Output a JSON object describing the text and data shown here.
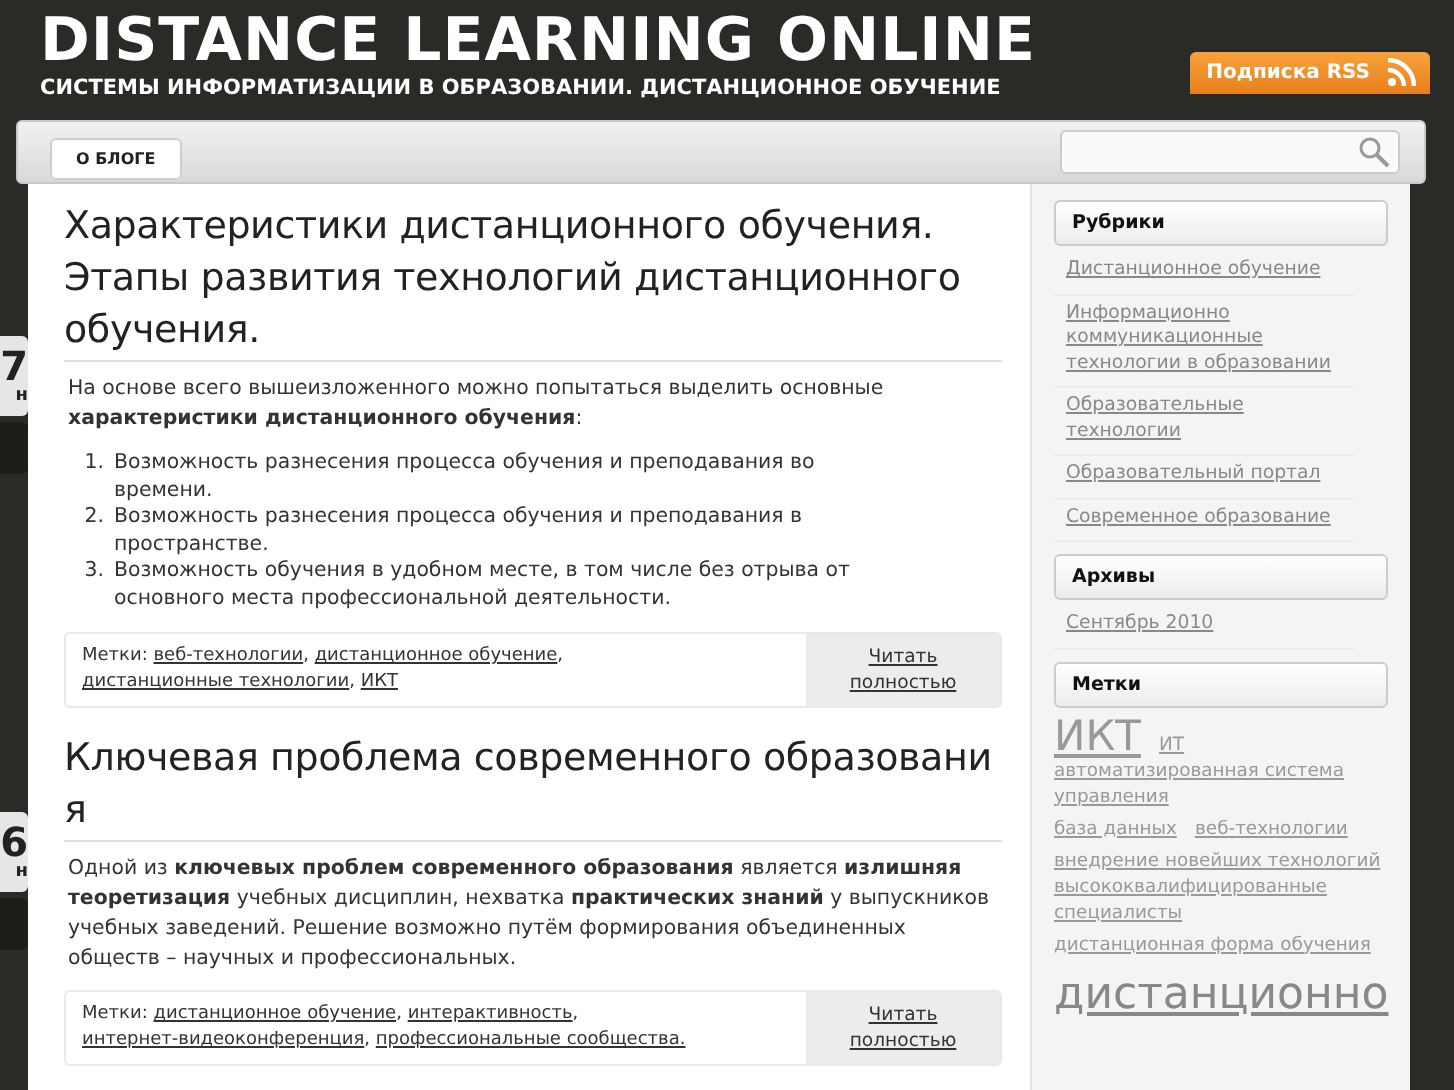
{
  "site": {
    "title": "DISTANCE LEARNING ONLINE",
    "tagline": "СИСТЕМЫ ИНФОРМАТИЗАЦИИ В ОБРАЗОВАНИИ. ДИСТАНЦИОННОЕ ОБУЧЕНИЕ",
    "rss": "Подписка RSS"
  },
  "nav": {
    "items": [
      {
        "label": "О БЛОГЕ",
        "selected": false
      }
    ]
  },
  "posts": [
    {
      "date": {
        "day": "7",
        "month": "н"
      },
      "title": "Характеристики дистанционного обучения. Этапы развития технологий дистанционного обучения.",
      "body": "На основе всего вышеизложенного можно попытаться выделить основные **характеристики дистанционного обучения**:",
      "list": [
        {
          "number": "1.",
          "text": "Возможность разнесения процесса обучения и преподавания во времени."
        },
        {
          "number": "2.",
          "text": "Возможность разнесения процесса обучения и преподавания в пространстве."
        },
        {
          "number": "3.",
          "text": "Возможность обучения в удобном месте, в том числе без отрыва от основного места профессиональной деятельности."
        }
      ],
      "tags_label": "Метки:",
      "tag_separator": ",",
      "tags": [
        "веб-технологии",
        "дистанционное обучение",
        "дистанционные технологии",
        "ИКТ"
      ],
      "more": "Читать полностью"
    },
    {
      "date": {
        "day": "6",
        "month": "н"
      },
      "title": "Ключевая проблема современного образовани я",
      "body": "Одной из **ключевых проблем современного образования** является **излишняя теоретизация** учебных дисциплин, нехватка **практических знаний** у выпускников учебных заведений. Решение возможно путём формирования объединенных обществ – научных и профессиональных.",
      "tags_label": "Метки:",
      "tag_separator": ",",
      "tags": [
        "дистанционное обучение",
        "интерактивность",
        "интернет-видеоконференция",
        "профессиональные сообщества."
      ],
      "more": "Читать полностью"
    }
  ],
  "sidebar": [
    {
      "heading": "Рубрики",
      "kind": "links",
      "items": [
        "Дистанционное обучение",
        "Информационно коммуникационные технологии в образовании",
        "Образовательные технологии",
        "Образовательный портал",
        "Современное образование"
      ]
    },
    {
      "heading": "Архивы",
      "kind": "links",
      "items": [
        "Сентябрь 2010"
      ]
    },
    {
      "heading": "Метки",
      "kind": "cloud",
      "items": [
        {
          "text": "ИКТ",
          "kind": "large"
        },
        {
          "text": "ИТ",
          "kind": "small"
        },
        {
          "text": "автоматизированная система управления",
          "kind": "small"
        },
        {
          "text": "база данных",
          "kind": "small"
        },
        {
          "text": "веб-технологии",
          "kind": "small"
        },
        {
          "text": "внедрение новейших технологий",
          "kind": "small"
        },
        {
          "text": "высококвалифицированные специалисты",
          "kind": "small"
        },
        {
          "text": "дистанционная форма обучения",
          "kind": "small"
        },
        {
          "text": "дистанционно",
          "kind": "huge"
        }
      ]
    }
  ]
}
